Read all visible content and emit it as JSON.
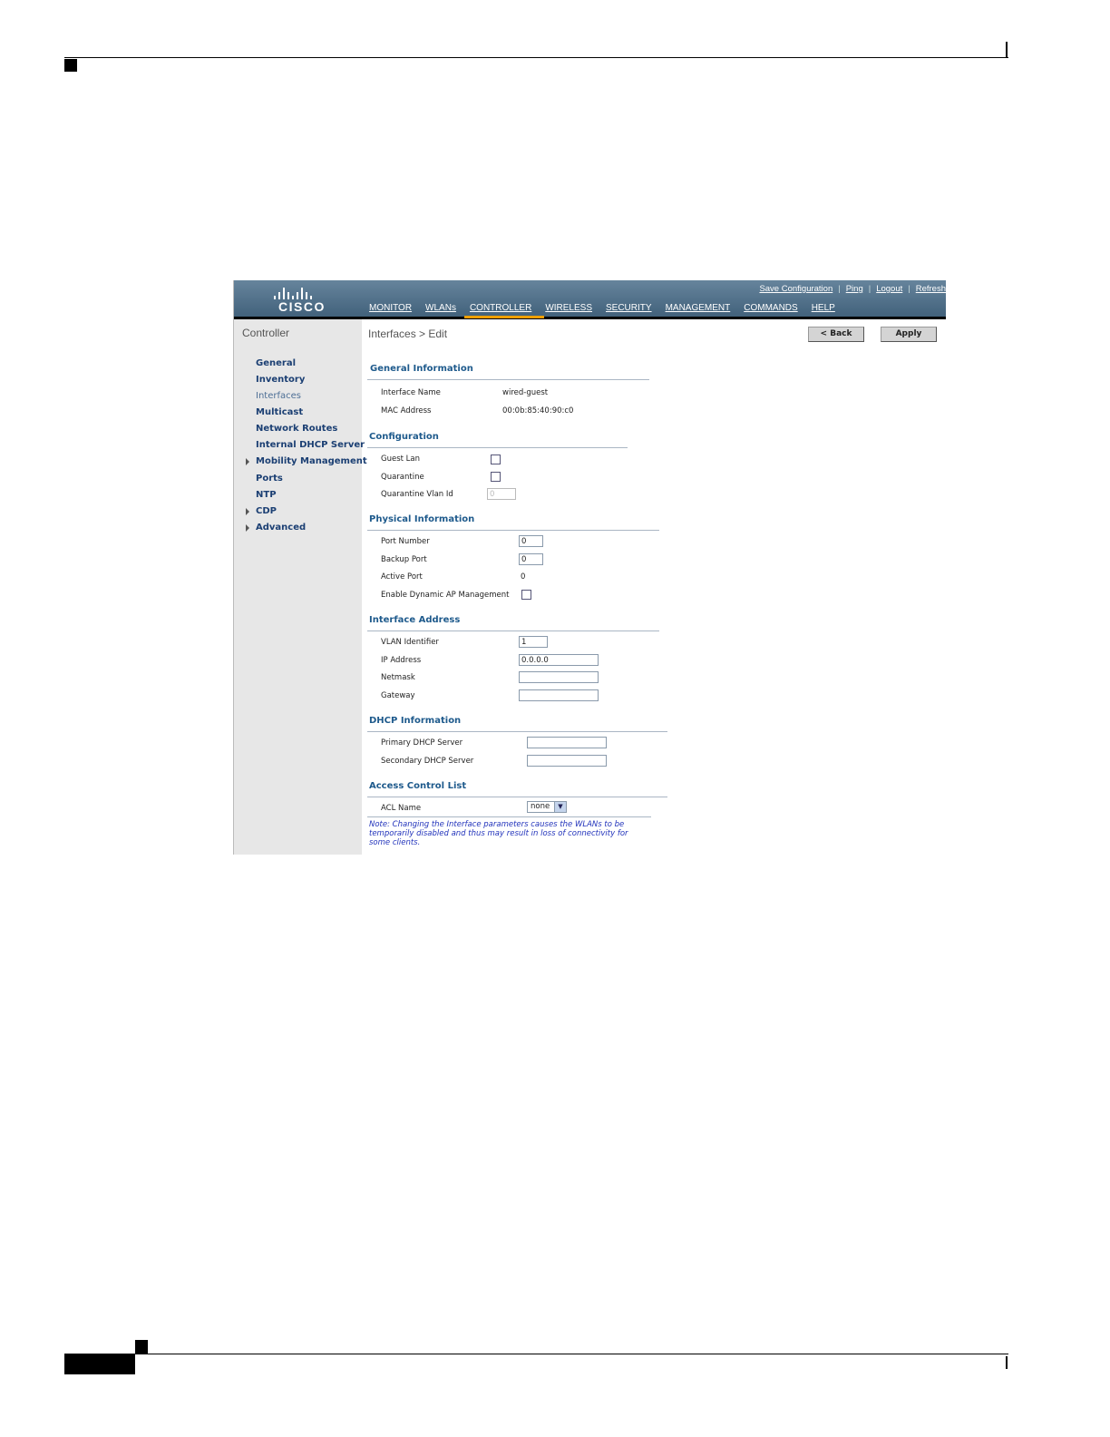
{
  "figure_id": "280648",
  "header": {
    "logo_text": "CISCO",
    "utility_links": [
      "Save Configuration",
      "Ping",
      "Logout",
      "Refresh"
    ],
    "nav_tabs": [
      {
        "label": "MONITOR",
        "active": false
      },
      {
        "label": "WLANs",
        "active": false
      },
      {
        "label": "CONTROLLER",
        "active": true
      },
      {
        "label": "WIRELESS",
        "active": false
      },
      {
        "label": "SECURITY",
        "active": false
      },
      {
        "label": "MANAGEMENT",
        "active": false
      },
      {
        "label": "COMMANDS",
        "active": false
      },
      {
        "label": "HELP",
        "active": false
      }
    ]
  },
  "sidebar": {
    "title": "Controller",
    "items": [
      {
        "label": "General",
        "expandable": false,
        "current": false
      },
      {
        "label": "Inventory",
        "expandable": false,
        "current": false
      },
      {
        "label": "Interfaces",
        "expandable": false,
        "current": true
      },
      {
        "label": "Multicast",
        "expandable": false,
        "current": false
      },
      {
        "label": "Network Routes",
        "expandable": false,
        "current": false
      },
      {
        "label": "Internal DHCP Server",
        "expandable": false,
        "current": false
      },
      {
        "label": "Mobility Management",
        "expandable": true,
        "current": false
      },
      {
        "label": "Ports",
        "expandable": false,
        "current": false
      },
      {
        "label": "NTP",
        "expandable": false,
        "current": false
      },
      {
        "label": "CDP",
        "expandable": true,
        "current": false
      },
      {
        "label": "Advanced",
        "expandable": true,
        "current": false
      }
    ]
  },
  "main": {
    "breadcrumb": "Interfaces > Edit",
    "back_label": "< Back",
    "apply_label": "Apply",
    "general": {
      "heading": "General Information",
      "interface_name_label": "Interface Name",
      "interface_name": "wired-guest",
      "mac_label": "MAC Address",
      "mac": "00:0b:85:40:90:c0"
    },
    "configuration": {
      "heading": "Configuration",
      "guest_lan_label": "Guest Lan",
      "guest_lan_checked": false,
      "quarantine_label": "Quarantine",
      "quarantine_checked": false,
      "quarantine_vlan_label": "Quarantine Vlan Id",
      "quarantine_vlan_value": "0"
    },
    "physical": {
      "heading": "Physical Information",
      "port_number_label": "Port Number",
      "port_number": "0",
      "backup_port_label": "Backup Port",
      "backup_port": "0",
      "active_port_label": "Active Port",
      "active_port": "0",
      "dynamic_ap_label": "Enable Dynamic AP Management",
      "dynamic_ap_checked": false
    },
    "address": {
      "heading": "Interface Address",
      "vlan_label": "VLAN Identifier",
      "vlan": "1",
      "ip_label": "IP Address",
      "ip": "0.0.0.0",
      "netmask_label": "Netmask",
      "netmask": "",
      "gateway_label": "Gateway",
      "gateway": ""
    },
    "dhcp": {
      "heading": "DHCP Information",
      "primary_label": "Primary DHCP Server",
      "primary": "",
      "secondary_label": "Secondary DHCP Server",
      "secondary": ""
    },
    "acl": {
      "heading": "Access Control List",
      "acl_label": "ACL Name",
      "acl_value": "none"
    },
    "note": "Note: Changing the Interface parameters causes the WLANs to be temporarily disabled and thus may result in loss of connectivity for some clients."
  }
}
